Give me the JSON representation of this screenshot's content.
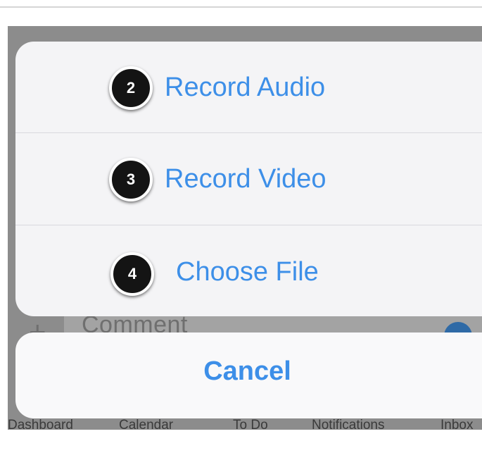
{
  "background": {
    "comment_placeholder": "Comment",
    "tabs": [
      "Dashboard",
      "Calendar",
      "To Do",
      "Notifications",
      "Inbox"
    ]
  },
  "action_sheet": {
    "items": [
      {
        "label": "Record Audio",
        "step": "2"
      },
      {
        "label": "Record Video",
        "step": "3"
      },
      {
        "label": "Choose File",
        "step": "4"
      }
    ],
    "cancel_label": "Cancel"
  },
  "colors": {
    "accent": "#3d8fe8",
    "overlay": "#8c8c8c",
    "badge": "#141414"
  }
}
